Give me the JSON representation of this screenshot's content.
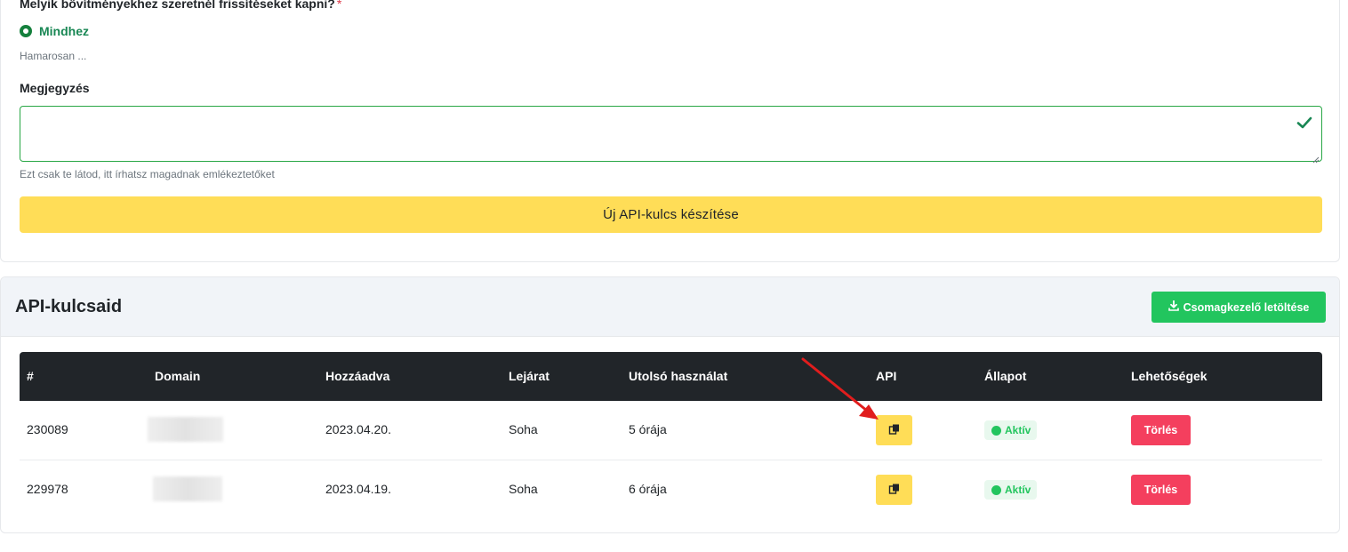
{
  "form": {
    "question": "Melyik bővítményekhez szeretnél frissítéseket kapni?",
    "required_mark": "*",
    "radio_selected": "Mindhez",
    "radio_hint": "Hamarosan ...",
    "note_label": "Megjegyzés",
    "note_value": "",
    "note_hint": "Ezt csak te látod, itt írhatsz magadnak emlékeztetőket",
    "submit_label": "Új API-kulcs készítése"
  },
  "keys": {
    "title": "API-kulcsaid",
    "download_label": "Csomagkezelő letöltése",
    "headers": [
      "#",
      "Domain",
      "Hozzáadva",
      "Lejárat",
      "Utolsó használat",
      "API",
      "Állapot",
      "Lehetőségek"
    ],
    "rows": [
      {
        "id": "230089",
        "added": "2023.04.20.",
        "expires": "Soha",
        "last_used": "5 órája",
        "status": "Aktív",
        "action": "Törlés"
      },
      {
        "id": "229978",
        "added": "2023.04.19.",
        "expires": "Soha",
        "last_used": "6 órája",
        "status": "Aktív",
        "action": "Törlés"
      }
    ]
  },
  "icons": {
    "radio": "radio-checked-icon",
    "valid": "check-icon",
    "download": "download-icon",
    "copy": "copy-icon",
    "annotation": "red-arrow-icon"
  },
  "colors": {
    "accent_yellow": "#ffdd57",
    "success_green": "#22c55e",
    "danger_red": "#f43f5e",
    "table_header": "#212529",
    "annotation_red": "#e11d1d"
  }
}
